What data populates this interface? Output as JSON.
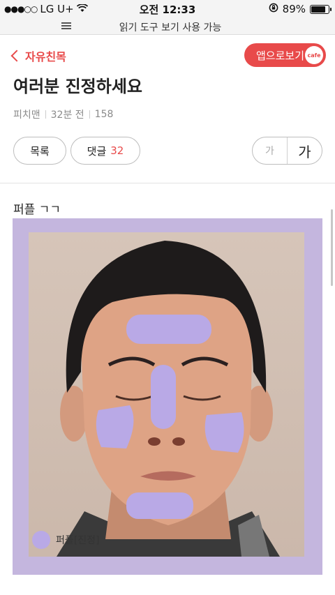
{
  "status_bar": {
    "carrier": "LG U+",
    "time": "오전 12:33",
    "battery": "89%",
    "battery_level": 0.89
  },
  "reader_bar": {
    "text": "읽기 도구 보기 사용 가능"
  },
  "header": {
    "back_label": "자유친목",
    "app_button_label": "앱으로보기",
    "cafe_badge": "cafe"
  },
  "post": {
    "title": "여러분 진정하세요",
    "author": "피치맨",
    "time_ago": "32분 전",
    "views": "158",
    "list_button": "목록",
    "comment_label": "댓글",
    "comment_count": "32",
    "font_small": "가",
    "font_large": "가",
    "body": "퍼플 ㄱㄱ",
    "image_caption": "퍼플[진정]"
  },
  "colors": {
    "accent": "#e84a4a",
    "purple": "#b9a9e6",
    "frame": "#c4b6de"
  }
}
